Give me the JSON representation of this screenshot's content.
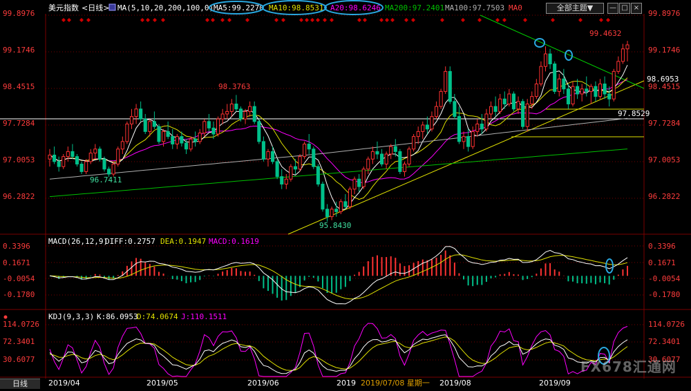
{
  "header": {
    "symbol": "美元指数",
    "period": "<日线>",
    "ma_spec": "MA(5,10,20,200,100,0)",
    "ma5": "MA5:99.2270",
    "ma10": "MA10:98.8531",
    "ma20": "A20:98.6246",
    "ma200": "MA200:97.2401",
    "ma100": "MA100:97.7503",
    "ma0": "MA0",
    "theme_button": "全部主题▼",
    "win_buttons": [
      "—",
      "□",
      "×"
    ]
  },
  "main_axis": {
    "ticks": [
      "99.8976",
      "99.1746",
      "98.4515",
      "97.7284",
      "97.0053",
      "96.2822"
    ],
    "right_extra": "98.6953"
  },
  "annotations": {
    "high_1": "98.3763",
    "low_1": "96.7411",
    "low_2": "95.8430",
    "last_high": "99.4632",
    "support_level": "97.8529"
  },
  "macd": {
    "title": "MACD(26,12,9)",
    "diff": "DIFF:0.2757",
    "dea": "DEA:0.1947",
    "macd": "MACD:0.1619",
    "ticks": [
      "0.3396",
      "0.1671",
      "-0.0054",
      "-0.1780"
    ]
  },
  "kdj": {
    "title": "KDJ(9,3,3)",
    "k": "K:86.0953",
    "d": "D:74.0674",
    "j": "J:110.1511",
    "ticks": [
      "114.0726",
      "72.3401",
      "30.6077"
    ]
  },
  "x_axis": {
    "labels": [
      "2019/04",
      "2019/05",
      "2019/06",
      "2019",
      "2019/07/08 星期一",
      "2019/08",
      "2019/09"
    ]
  },
  "footer": {
    "period_tab": "日线",
    "watermark": "FX678汇通网"
  },
  "colors": {
    "up": "#ff3232",
    "down": "#00c08a",
    "ma5": "#ffffff",
    "ma10": "#e0e000",
    "ma20": "#ff00ff",
    "ma200": "#00c000",
    "ma100": "#b0b0b0",
    "grid": "#7a0000",
    "axis_text": "#ff3c3c",
    "highlight_oval": "#29a8e0"
  },
  "chart_data": {
    "type": "candlestick",
    "title": "美元指数 <日线>",
    "ylim": [
      95.6,
      100.0
    ],
    "x_range": [
      "2019/04",
      "2019/09"
    ],
    "ohlc": [
      [
        97.1,
        97.3,
        96.95,
        97.18
      ],
      [
        97.18,
        97.35,
        97.0,
        97.05
      ],
      [
        97.05,
        97.15,
        96.85,
        96.95
      ],
      [
        96.95,
        97.2,
        96.9,
        97.15
      ],
      [
        97.15,
        97.35,
        97.05,
        97.25
      ],
      [
        97.25,
        97.4,
        97.1,
        97.15
      ],
      [
        97.15,
        97.2,
        96.95,
        97.0
      ],
      [
        97.0,
        97.05,
        96.8,
        96.85
      ],
      [
        96.85,
        97.1,
        96.8,
        97.05
      ],
      [
        97.05,
        97.3,
        97.0,
        97.22
      ],
      [
        97.22,
        97.4,
        97.1,
        97.3
      ],
      [
        97.3,
        97.35,
        97.05,
        97.1
      ],
      [
        97.1,
        97.15,
        96.85,
        96.9
      ],
      [
        96.9,
        96.95,
        96.74,
        96.8
      ],
      [
        96.8,
        97.05,
        96.75,
        97.0
      ],
      [
        97.0,
        97.35,
        96.95,
        97.3
      ],
      [
        97.3,
        97.55,
        97.2,
        97.45
      ],
      [
        97.45,
        97.85,
        97.4,
        97.8
      ],
      [
        97.8,
        98.1,
        97.7,
        97.95
      ],
      [
        97.95,
        98.2,
        97.8,
        98.1
      ],
      [
        98.1,
        98.25,
        97.85,
        97.9
      ],
      [
        97.9,
        98.0,
        97.6,
        97.65
      ],
      [
        97.65,
        97.9,
        97.55,
        97.85
      ],
      [
        97.85,
        98.05,
        97.7,
        97.75
      ],
      [
        97.75,
        97.8,
        97.4,
        97.45
      ],
      [
        97.45,
        97.7,
        97.35,
        97.65
      ],
      [
        97.65,
        97.85,
        97.5,
        97.55
      ],
      [
        97.55,
        97.7,
        97.3,
        97.4
      ],
      [
        97.4,
        97.6,
        97.3,
        97.55
      ],
      [
        97.55,
        97.65,
        97.35,
        97.42
      ],
      [
        97.42,
        97.5,
        97.2,
        97.3
      ],
      [
        97.3,
        97.55,
        97.25,
        97.5
      ],
      [
        97.5,
        97.65,
        97.35,
        97.45
      ],
      [
        97.45,
        97.7,
        97.4,
        97.62
      ],
      [
        97.62,
        97.9,
        97.55,
        97.85
      ],
      [
        97.85,
        98.0,
        97.65,
        97.72
      ],
      [
        97.72,
        97.85,
        97.5,
        97.6
      ],
      [
        97.6,
        97.95,
        97.55,
        97.9
      ],
      [
        97.9,
        98.1,
        97.8,
        98.0
      ],
      [
        98.0,
        98.2,
        97.9,
        98.05
      ],
      [
        98.05,
        98.3,
        97.95,
        98.2
      ],
      [
        98.2,
        98.38,
        98.05,
        98.1
      ],
      [
        98.1,
        98.15,
        97.85,
        97.9
      ],
      [
        97.9,
        98.1,
        97.8,
        98.05
      ],
      [
        98.05,
        98.25,
        97.95,
        98.15
      ],
      [
        98.15,
        98.25,
        97.8,
        97.85
      ],
      [
        97.85,
        97.9,
        97.4,
        97.45
      ],
      [
        97.45,
        97.55,
        97.05,
        97.1
      ],
      [
        97.1,
        97.3,
        96.95,
        97.25
      ],
      [
        97.25,
        97.35,
        97.0,
        97.05
      ],
      [
        97.05,
        97.1,
        96.7,
        96.75
      ],
      [
        96.75,
        96.9,
        96.5,
        96.6
      ],
      [
        96.6,
        96.8,
        96.5,
        96.7
      ],
      [
        96.7,
        97.0,
        96.65,
        96.95
      ],
      [
        96.95,
        97.1,
        96.8,
        96.9
      ],
      [
        96.9,
        97.2,
        96.85,
        97.15
      ],
      [
        97.15,
        97.45,
        97.1,
        97.4
      ],
      [
        97.4,
        97.6,
        97.2,
        97.3
      ],
      [
        97.3,
        97.35,
        96.9,
        96.95
      ],
      [
        96.95,
        97.0,
        96.55,
        96.6
      ],
      [
        96.6,
        96.65,
        96.05,
        96.1
      ],
      [
        96.1,
        96.2,
        95.85,
        95.95
      ],
      [
        95.95,
        96.15,
        95.88,
        96.1
      ],
      [
        96.1,
        96.25,
        95.95,
        96.05
      ],
      [
        96.05,
        96.3,
        96.0,
        96.25
      ],
      [
        96.25,
        96.4,
        96.1,
        96.15
      ],
      [
        96.15,
        96.55,
        96.1,
        96.5
      ],
      [
        96.5,
        96.75,
        96.4,
        96.7
      ],
      [
        96.7,
        96.8,
        96.45,
        96.55
      ],
      [
        96.55,
        96.95,
        96.5,
        96.9
      ],
      [
        96.9,
        97.15,
        96.8,
        97.1
      ],
      [
        97.1,
        97.35,
        97.0,
        97.25
      ],
      [
        97.25,
        97.45,
        97.1,
        97.2
      ],
      [
        97.2,
        97.3,
        96.95,
        97.0
      ],
      [
        97.0,
        97.25,
        96.9,
        97.2
      ],
      [
        97.2,
        97.4,
        97.1,
        97.35
      ],
      [
        97.35,
        97.5,
        97.15,
        97.25
      ],
      [
        97.25,
        97.3,
        96.8,
        96.85
      ],
      [
        96.85,
        97.05,
        96.75,
        97.0
      ],
      [
        97.0,
        97.35,
        96.95,
        97.3
      ],
      [
        97.3,
        97.6,
        97.25,
        97.55
      ],
      [
        97.55,
        97.75,
        97.4,
        97.65
      ],
      [
        97.65,
        97.85,
        97.5,
        97.78
      ],
      [
        97.78,
        97.95,
        97.6,
        97.7
      ],
      [
        97.7,
        98.05,
        97.65,
        97.95
      ],
      [
        97.95,
        98.25,
        97.9,
        98.15
      ],
      [
        98.15,
        98.5,
        98.1,
        98.45
      ],
      [
        98.45,
        98.95,
        98.4,
        98.85
      ],
      [
        98.85,
        98.95,
        98.2,
        98.25
      ],
      [
        98.25,
        98.4,
        97.9,
        97.95
      ],
      [
        97.95,
        98.15,
        97.4,
        97.45
      ],
      [
        97.45,
        97.65,
        97.3,
        97.55
      ],
      [
        97.55,
        97.7,
        97.25,
        97.35
      ],
      [
        97.35,
        97.75,
        97.3,
        97.65
      ],
      [
        97.65,
        97.9,
        97.55,
        97.8
      ],
      [
        97.8,
        98.0,
        97.6,
        97.7
      ],
      [
        97.7,
        98.1,
        97.65,
        98.0
      ],
      [
        98.0,
        98.25,
        97.9,
        98.15
      ],
      [
        98.15,
        98.35,
        97.95,
        98.05
      ],
      [
        98.05,
        98.4,
        98.0,
        98.3
      ],
      [
        98.3,
        98.45,
        98.1,
        98.2
      ],
      [
        98.2,
        98.5,
        98.15,
        98.4
      ],
      [
        98.4,
        98.45,
        98.05,
        98.1
      ],
      [
        98.1,
        98.35,
        98.0,
        98.25
      ],
      [
        98.25,
        98.3,
        97.7,
        97.75
      ],
      [
        97.75,
        98.3,
        97.65,
        98.2
      ],
      [
        98.2,
        98.45,
        98.1,
        98.35
      ],
      [
        98.35,
        98.7,
        98.3,
        98.6
      ],
      [
        98.6,
        99.05,
        98.55,
        98.95
      ],
      [
        98.95,
        99.35,
        98.85,
        99.2
      ],
      [
        99.2,
        99.3,
        98.9,
        99.0
      ],
      [
        99.0,
        99.05,
        98.4,
        98.45
      ],
      [
        98.45,
        98.8,
        98.35,
        98.7
      ],
      [
        98.7,
        98.9,
        98.4,
        98.5
      ],
      [
        98.5,
        98.6,
        98.1,
        98.2
      ],
      [
        98.2,
        98.65,
        98.15,
        98.55
      ],
      [
        98.55,
        98.7,
        98.3,
        98.4
      ],
      [
        98.4,
        98.6,
        98.25,
        98.5
      ],
      [
        98.5,
        98.75,
        98.35,
        98.45
      ],
      [
        98.45,
        98.6,
        98.2,
        98.55
      ],
      [
        98.55,
        98.65,
        98.25,
        98.35
      ],
      [
        98.35,
        98.7,
        98.3,
        98.6
      ],
      [
        98.6,
        98.75,
        98.3,
        98.4
      ],
      [
        98.4,
        98.55,
        98.15,
        98.3
      ],
      [
        98.3,
        98.9,
        98.25,
        98.85
      ],
      [
        98.85,
        99.15,
        98.8,
        99.05
      ],
      [
        99.05,
        99.4,
        99.0,
        99.3
      ],
      [
        99.3,
        99.46,
        99.05,
        99.38
      ]
    ],
    "series": [
      {
        "name": "MA5",
        "values": [
          99.227
        ]
      },
      {
        "name": "MA10",
        "values": [
          98.8531
        ]
      },
      {
        "name": "MA20",
        "values": [
          98.6246
        ]
      },
      {
        "name": "MA200",
        "values": [
          97.2401
        ]
      },
      {
        "name": "MA100",
        "values": [
          97.7503
        ]
      }
    ],
    "reference_levels": [
      97.8529
    ],
    "sub_charts": [
      {
        "type": "macd",
        "ylim": [
          -0.33,
          0.4
        ],
        "diff": 0.2757,
        "dea": 0.1947,
        "macd": 0.1619
      },
      {
        "type": "kdj",
        "ylim": [
          5,
          125
        ],
        "k": 86.0953,
        "d": 74.0674,
        "j": 110.1511
      }
    ]
  }
}
